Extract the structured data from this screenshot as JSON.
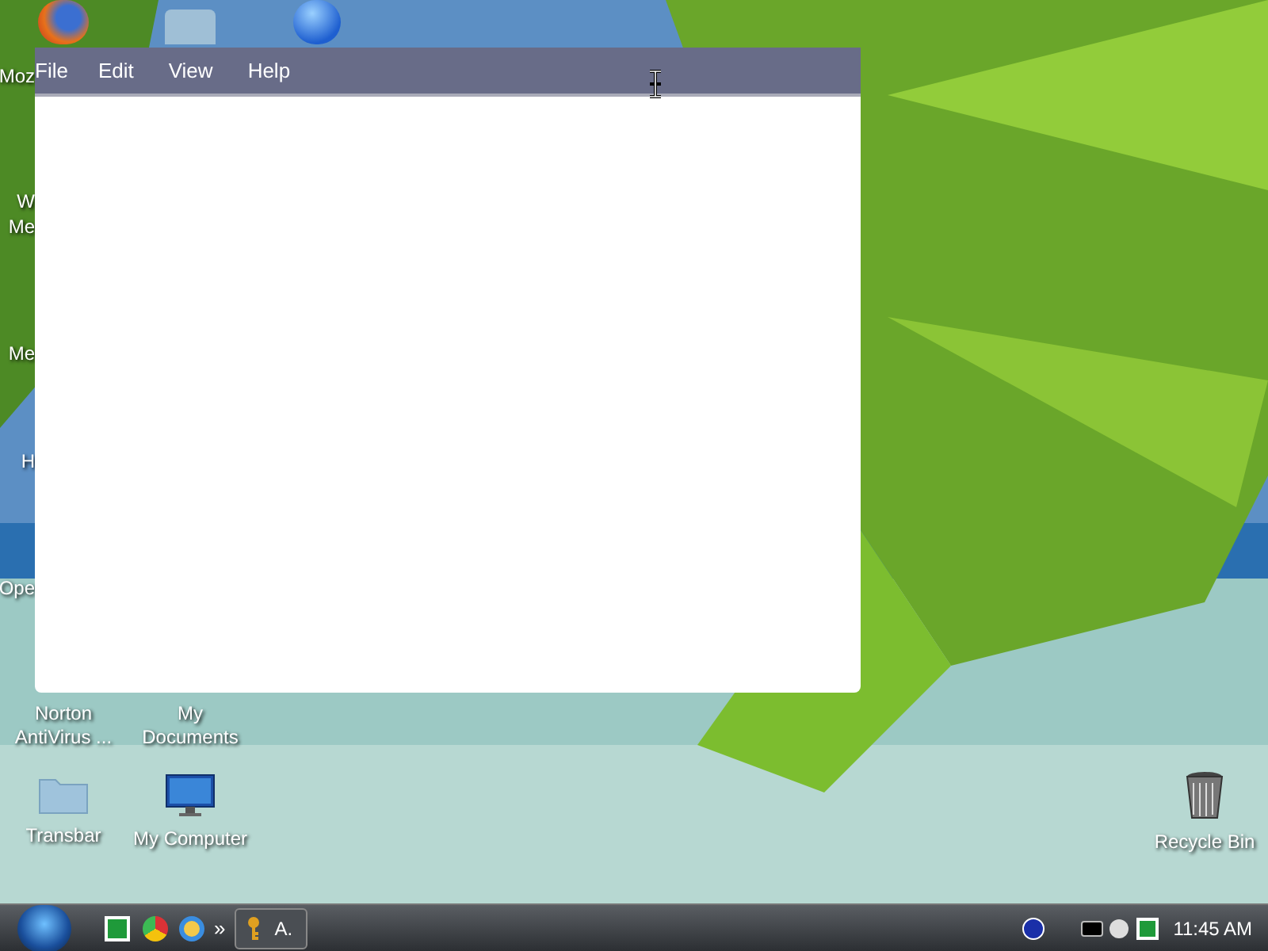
{
  "window": {
    "menu": [
      "File",
      "Edit",
      "View",
      "Help"
    ]
  },
  "desktop": {
    "cut_labels": [
      "Moz",
      "W",
      "Me",
      "Me",
      "H",
      "Ope"
    ],
    "icons": [
      {
        "kind": "hidden",
        "label": "Norton AntiVirus ..."
      },
      {
        "kind": "hidden",
        "label": "My Documents"
      },
      {
        "kind": "folder",
        "label": "Transbar"
      },
      {
        "kind": "monitor",
        "label": "My Computer"
      },
      {
        "kind": "bin",
        "label": "Recycle Bin"
      }
    ]
  },
  "taskbar": {
    "overflow": "»",
    "task_button": "A.",
    "clock": "11:45 AM"
  }
}
